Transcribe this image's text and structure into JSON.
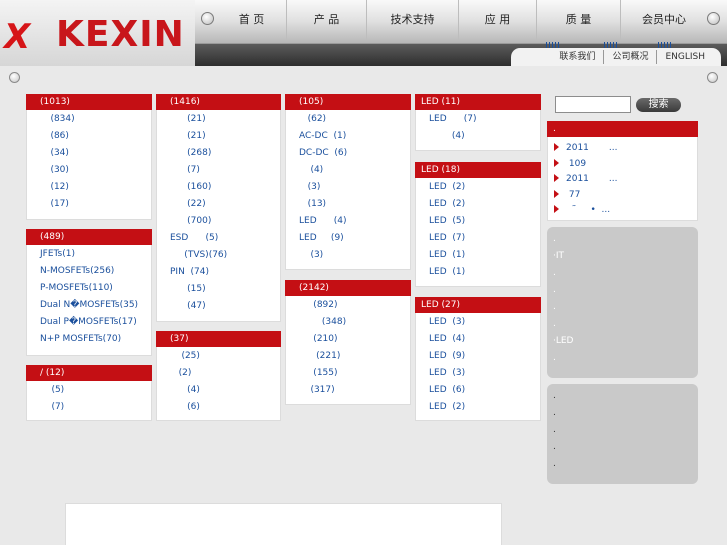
{
  "logo": {
    "mark": "X",
    "text": "KEXIN"
  },
  "nav": {
    "items": [
      "首 页",
      "产 品",
      "技术支持",
      "应 用",
      "质 量",
      "会员中心"
    ]
  },
  "subnav": {
    "items": [
      "联系我们",
      "公司概况",
      "ENGLISH"
    ]
  },
  "columns": [
    [
      {
        "head": "(1013)",
        "items": [
          "    (834)",
          "    (86)",
          "    (34)",
          "    (30)",
          "    (12)",
          "    (17)"
        ]
      },
      {
        "head": "(489)",
        "items": [
          "JFETs(1)",
          "N-MOSFETs(256)",
          "P-MOSFETs(110)",
          "Dual N�MOSFETs(35)",
          "Dual P�MOSFETs(17)",
          "N+P MOSFETs(70)"
        ]
      },
      {
        "head": "/  (12)",
        "items": [
          "    (5)",
          "    (7)"
        ]
      }
    ],
    [
      {
        "head": "(1416)",
        "items": [
          "      (21)",
          "      (21)",
          "      (268)",
          "      (7)",
          "      (160)",
          "      (22)",
          "      (700)",
          "ESD      (5)",
          "     (TVS)(76)",
          "PIN  (74)",
          "      (15)",
          "      (47)"
        ]
      },
      {
        "head": "(37)",
        "items": [
          "    (25)",
          "   (2)",
          "      (4)",
          "      (6)"
        ]
      }
    ],
    [
      {
        "head": "(105)",
        "items": [
          "   (62)",
          "AC-DC  (1)",
          "DC-DC  (6)",
          "    (4)",
          "   (3)",
          "   (13)",
          "LED      (4)",
          "LED     (9)",
          "    (3)"
        ]
      },
      {
        "head": "(2142)",
        "items": [
          "     (892)",
          "        (348)",
          "     (210)",
          "      (221)",
          "     (155)",
          "    (317)"
        ]
      }
    ],
    [
      {
        "head": "LED      (11)",
        "items": [
          "LED      (7)",
          "        (4)"
        ]
      },
      {
        "head": "LED   (18)",
        "items": [
          "LED  (2)",
          "LED  (2)",
          "LED  (5)",
          "LED  (7)",
          "LED  (1)",
          "LED  (1)"
        ]
      },
      {
        "head": "LED   (27)",
        "items": [
          "LED  (3)",
          "LED  (4)",
          "LED  (9)",
          "LED  (3)",
          "LED  (6)",
          "LED  (2)"
        ]
      }
    ]
  ],
  "search": {
    "placeholder": "",
    "button_label": "搜索"
  },
  "news": {
    "head": ".",
    "items": [
      "2011       ...",
      " 109",
      "2011       ...",
      " 77",
      "  ˜     •  ..."
    ]
  },
  "gray_box_1": {
    "items": [
      ".",
      "·IT",
      ".",
      ".",
      ".",
      ".",
      "·LED",
      "."
    ]
  },
  "gray_box_2": {
    "items": [
      ".",
      ".",
      ".",
      ".",
      "."
    ]
  },
  "colors": {
    "accent": "#c40f14",
    "link": "#1a4f9c",
    "background": "#e9e9e9"
  }
}
